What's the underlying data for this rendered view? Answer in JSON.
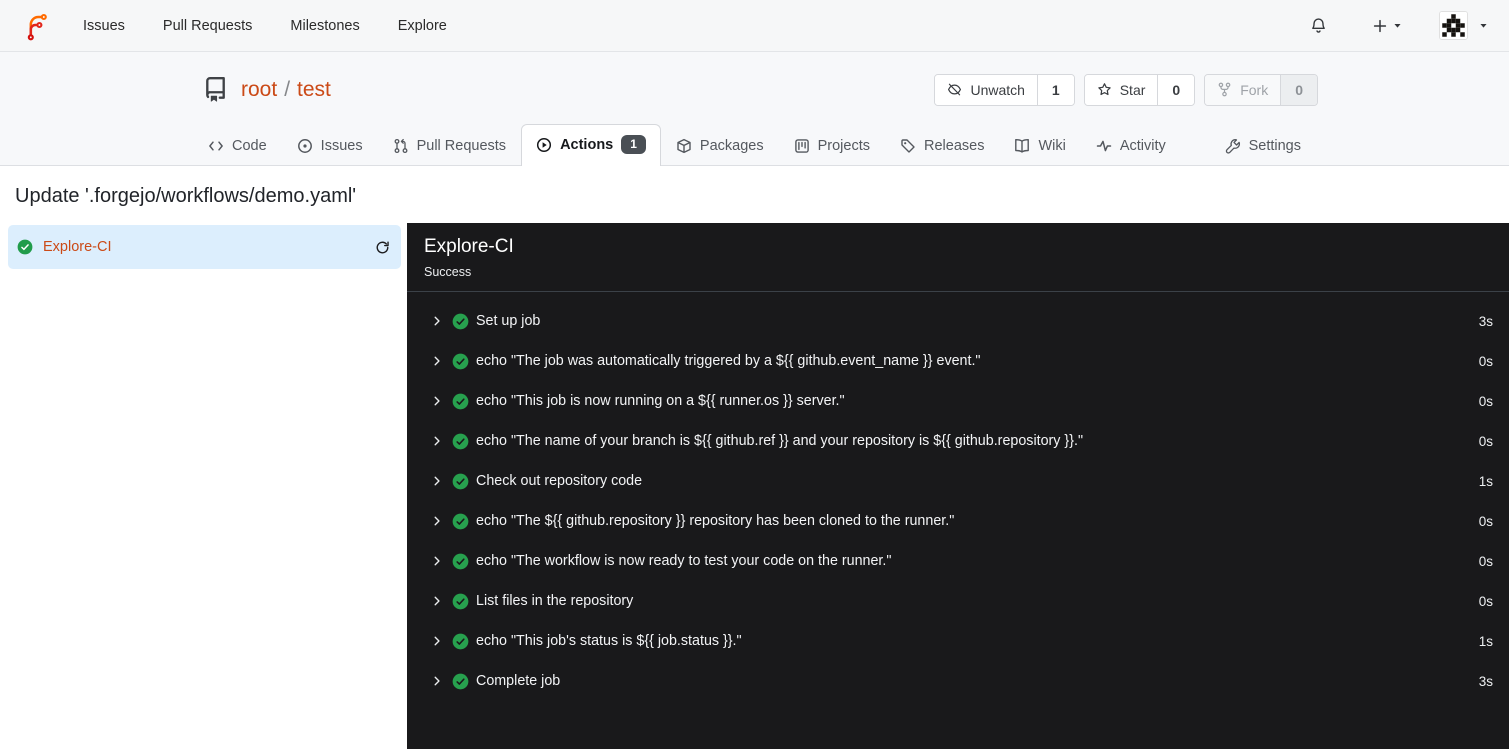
{
  "navbar": {
    "links": [
      {
        "label": "Issues"
      },
      {
        "label": "Pull Requests"
      },
      {
        "label": "Milestones"
      },
      {
        "label": "Explore"
      }
    ]
  },
  "repo": {
    "owner": "root",
    "separator": "/",
    "name": "test",
    "buttons": {
      "unwatch": {
        "label": "Unwatch",
        "count": "1"
      },
      "star": {
        "label": "Star",
        "count": "0"
      },
      "fork": {
        "label": "Fork",
        "count": "0",
        "disabled": true
      }
    }
  },
  "tabs": {
    "code": {
      "label": "Code"
    },
    "issues": {
      "label": "Issues"
    },
    "pull_requests": {
      "label": "Pull Requests"
    },
    "actions": {
      "label": "Actions",
      "badge": "1",
      "active": true
    },
    "packages": {
      "label": "Packages"
    },
    "projects": {
      "label": "Projects"
    },
    "releases": {
      "label": "Releases"
    },
    "wiki": {
      "label": "Wiki"
    },
    "activity": {
      "label": "Activity"
    },
    "settings": {
      "label": "Settings"
    }
  },
  "page": {
    "title": "Update '.forgejo/workflows/demo.yaml'"
  },
  "sidebar": {
    "job_name": "Explore-CI",
    "job_status": "success"
  },
  "run_panel": {
    "title": "Explore-CI",
    "status_text": "Success",
    "steps": [
      {
        "name": "Set up job",
        "duration": "3s"
      },
      {
        "name": "echo \"The job was automatically triggered by a ${{ github.event_name }} event.\"",
        "duration": "0s"
      },
      {
        "name": "echo \"This job is now running on a ${{ runner.os }} server.\"",
        "duration": "0s"
      },
      {
        "name": "echo \"The name of your branch is ${{ github.ref }} and your repository is ${{ github.repository }}.\"",
        "duration": "0s"
      },
      {
        "name": "Check out repository code",
        "duration": "1s"
      },
      {
        "name": "echo \"The ${{ github.repository }} repository has been cloned to the runner.\"",
        "duration": "0s"
      },
      {
        "name": "echo \"The workflow is now ready to test your code on the runner.\"",
        "duration": "0s"
      },
      {
        "name": "List files in the repository",
        "duration": "0s"
      },
      {
        "name": "echo \"This job's status is ${{ job.status }}.\"",
        "duration": "1s"
      },
      {
        "name": "Complete job",
        "duration": "3s"
      }
    ]
  },
  "colors": {
    "primary": "#cb4a17",
    "success-green": "#219c4b",
    "panel-bg": "#19191b",
    "panel-border": "#3b4148",
    "selected-item-bg": "#dceefd",
    "badge-bg": "#4a4f55"
  }
}
